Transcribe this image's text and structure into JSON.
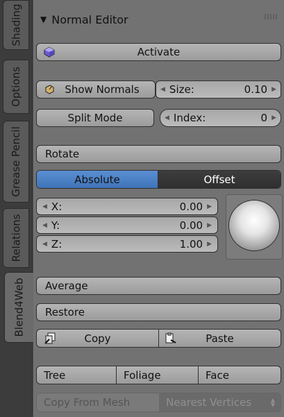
{
  "tabs": [
    {
      "label": "Shading"
    },
    {
      "label": "Options"
    },
    {
      "label": "Grease Pencil"
    },
    {
      "label": "Relations"
    },
    {
      "label": "Blend4Web"
    }
  ],
  "panel": {
    "title": "Normal Editor",
    "activate_label": "Activate",
    "show_normals_label": "Show Normals",
    "size_label": "Size:",
    "size_value": "0.10",
    "split_mode_label": "Split Mode",
    "index_label": "Index:",
    "index_value": "0",
    "rotate_label": "Rotate",
    "absolute_label": "Absolute",
    "offset_label": "Offset",
    "x_label": "X:",
    "x_value": "0.00",
    "y_label": "Y:",
    "y_value": "0.00",
    "z_label": "Z:",
    "z_value": "1.00",
    "average_label": "Average",
    "restore_label": "Restore",
    "copy_label": "Copy",
    "paste_label": "Paste",
    "tree_label": "Tree",
    "foliage_label": "Foliage",
    "face_label": "Face",
    "copy_from_mesh_label": "Copy From Mesh",
    "nearest_vertices_label": "Nearest Vertices"
  }
}
